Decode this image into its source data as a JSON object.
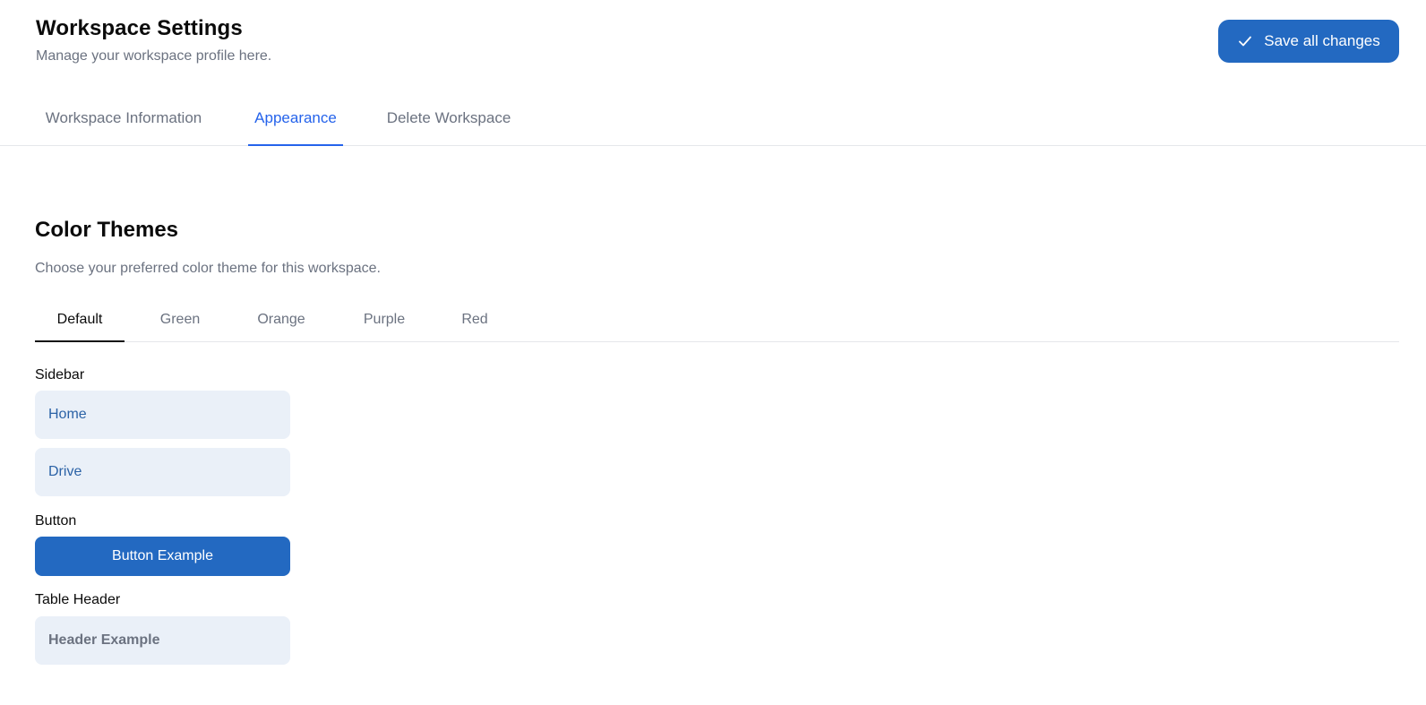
{
  "header": {
    "title": "Workspace Settings",
    "subtitle": "Manage your workspace profile here.",
    "save_label": "Save all changes"
  },
  "tabs": [
    {
      "label": "Workspace Information",
      "active": false
    },
    {
      "label": "Appearance",
      "active": true
    },
    {
      "label": "Delete Workspace",
      "active": false
    }
  ],
  "color_themes": {
    "title": "Color Themes",
    "description": "Choose your preferred color theme for this workspace.",
    "themes": [
      {
        "label": "Default",
        "active": true
      },
      {
        "label": "Green",
        "active": false
      },
      {
        "label": "Orange",
        "active": false
      },
      {
        "label": "Purple",
        "active": false
      },
      {
        "label": "Red",
        "active": false
      }
    ]
  },
  "preview": {
    "sidebar_label": "Sidebar",
    "sidebar_items": [
      "Home",
      "Drive"
    ],
    "button_label": "Button",
    "button_example": "Button Example",
    "table_header_label": "Table Header",
    "header_example": "Header Example"
  },
  "colors": {
    "primary": "#2369c1",
    "accent_tab": "#2563eb",
    "sidebar_bg": "#eaf0f8",
    "sidebar_text": "#2b62a6"
  }
}
